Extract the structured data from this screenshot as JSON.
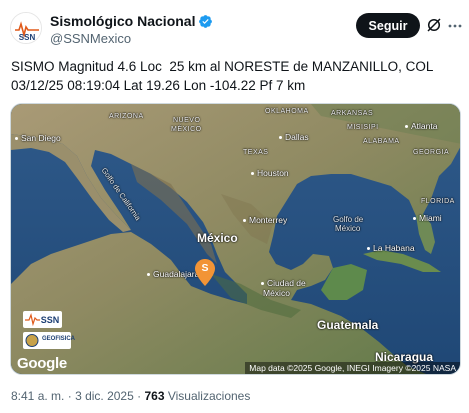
{
  "author": {
    "display_name": "Sismológico Nacional",
    "handle": "@SSNMexico",
    "avatar_text": "SSN",
    "verified_icon": "verified-badge-icon"
  },
  "actions": {
    "follow_label": "Seguir",
    "grok_icon": "grok-icon",
    "more_icon": "more-options-icon"
  },
  "post": {
    "text_line_1": "SISMO Magnitud 4.6 Loc  25 km al NORESTE de MANZANILLO, COL",
    "text_line_2": "03/12/25 08:19:04 Lat 19.26 Lon -104.22 Pf 7 km"
  },
  "map": {
    "marker_letter": "S",
    "attribution": "Map data ©2025 Google, INEGI Imagery ©2025 NASA",
    "google_logo": "Google",
    "logo_ssn_text": "SSN",
    "logo_geofisica_text": "GEOFISICA",
    "labels": {
      "arizona": "ARIZONA",
      "nuevo_mexico_1": "NUEVO",
      "nuevo_mexico_2": "MÉXICO",
      "oklahoma": "OKLAHOMA",
      "arkansas": "ARKANSAS",
      "misisipi": "MISISIPI",
      "alabama": "ALABAMA",
      "georgia": "GEORGIA",
      "texas": "TEXAS",
      "florida": "FLORIDA",
      "san_diego": "San Diego",
      "dallas": "Dallas",
      "atlanta": "Atlanta",
      "houston": "Houston",
      "gulf_california": "Golfo de California",
      "monterrey": "Monterrey",
      "gulf_mexico_1": "Golfo de",
      "gulf_mexico_2": "México",
      "miami": "Miami",
      "mexico": "México",
      "la_habana": "La Habana",
      "guadalajara": "Guadalajara",
      "ciudad_mexico_1": "Ciudad de",
      "ciudad_mexico_2": "México",
      "guatemala": "Guatemala",
      "nicaragua": "Nicaragua"
    }
  },
  "meta": {
    "time": "8:41 a. m.",
    "separator": "·",
    "date": "3 dic. 2025",
    "views_count": "763",
    "views_label": "Visualizaciones"
  }
}
